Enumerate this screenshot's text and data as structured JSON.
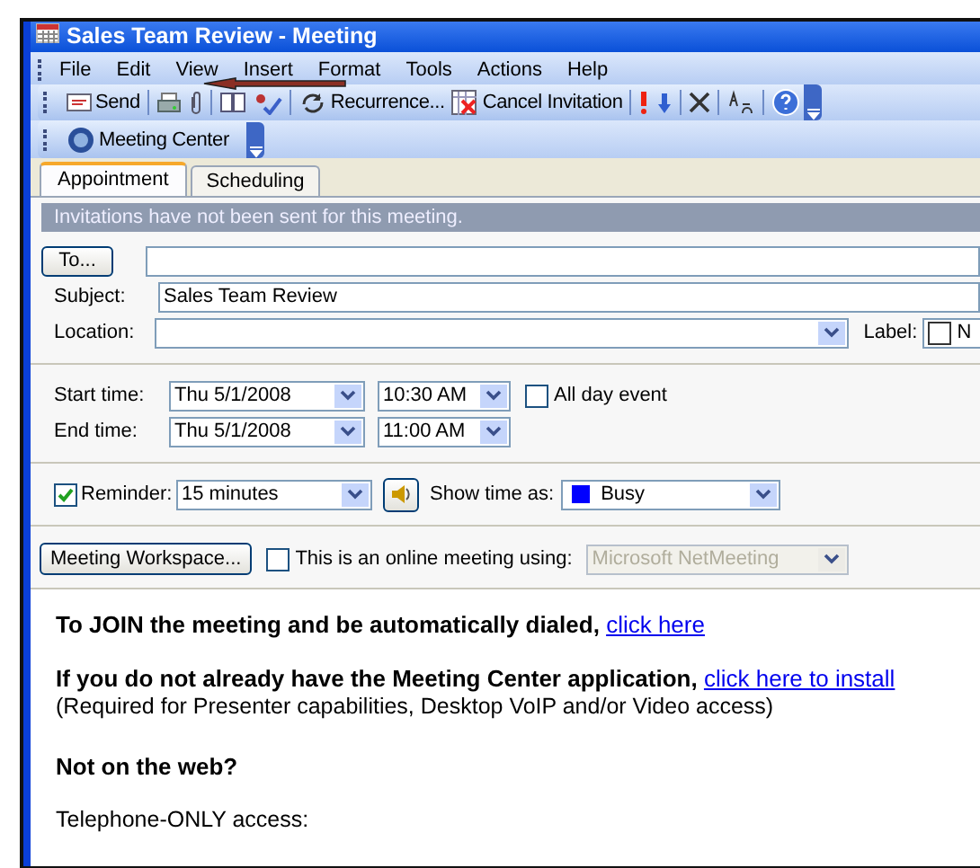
{
  "window": {
    "title": "Sales Team Review - Meeting"
  },
  "menu": [
    "File",
    "Edit",
    "View",
    "Insert",
    "Format",
    "Tools",
    "Actions",
    "Help"
  ],
  "toolbar": [
    {
      "label": "Send"
    },
    {
      "label": "Recurrence..."
    },
    {
      "label": "Cancel Invitation"
    }
  ],
  "meeting_center": {
    "label": "Meeting Center"
  },
  "tabs": [
    {
      "label": "Appointment",
      "selected": true
    },
    {
      "label": "Scheduling",
      "selected": false
    }
  ],
  "info_bar": "Invitations have not been sent for this meeting.",
  "to_button": "To...",
  "subject": {
    "label": "Subject:",
    "value": "Sales Team Review"
  },
  "location": {
    "label": "Location:"
  },
  "label_field": {
    "label": "Label:",
    "value": "N"
  },
  "start": {
    "label": "Start time:",
    "date": "Thu 5/1/2008",
    "time": "10:30 AM"
  },
  "end": {
    "label": "End time:",
    "date": "Thu 5/1/2008",
    "time": "11:00 AM"
  },
  "all_day": {
    "label": "All day event",
    "checked": false
  },
  "reminder": {
    "label": "Reminder:",
    "checked": true,
    "value": "15 minutes"
  },
  "show_time_as": {
    "label": "Show time as:",
    "value": "Busy",
    "color": "#0000ff"
  },
  "workspace_button": "Meeting Workspace...",
  "online": {
    "label": "This is an online meeting using:",
    "checked": false,
    "value": "Microsoft NetMeeting",
    "disabled": true
  },
  "body": [
    {
      "kind": "link_line",
      "text": "To JOIN the meeting and be automatically dialed,",
      "link": "click here"
    },
    {
      "kind": "link_line",
      "text": "If you do not already have the Meeting Center application,",
      "link": "click here to install"
    },
    {
      "kind": "plain",
      "text": "(Required for Presenter capabilities, Desktop VoIP and/or Video access)"
    },
    {
      "kind": "heading",
      "text": "Not on the web?"
    },
    {
      "kind": "plain",
      "text": "Telephone-ONLY access:"
    }
  ]
}
